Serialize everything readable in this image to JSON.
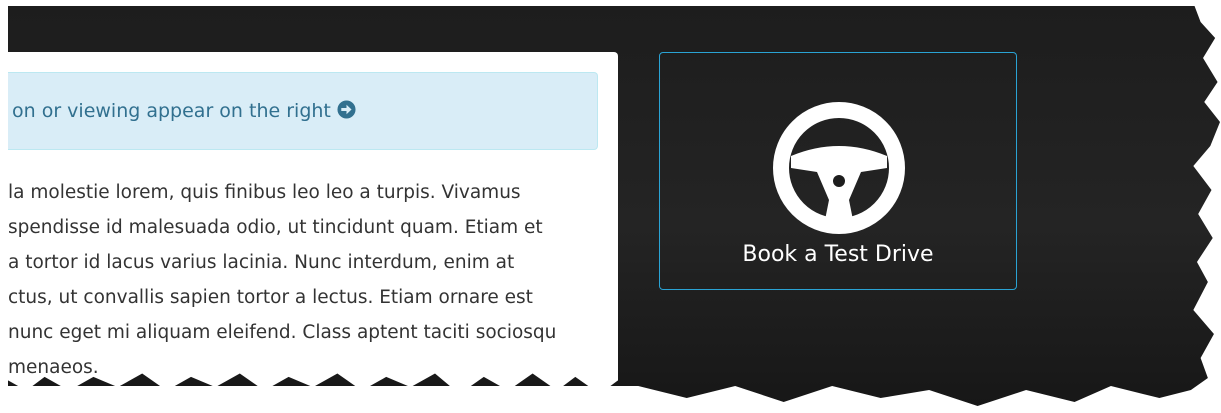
{
  "alert": {
    "text": "on or viewing appear on the right",
    "icon": "arrow-circle-right-icon"
  },
  "paragraph": {
    "lines": [
      "la molestie lorem, quis finibus leo leo a turpis. Vivamus",
      "spendisse id malesuada odio, ut tincidunt quam. Etiam et",
      "a tortor id lacus varius lacinia. Nunc interdum, enim at",
      "ctus, ut convallis sapien tortor a lectus. Etiam ornare est",
      "nunc eget mi aliquam eleifend. Class aptent taciti sociosqu",
      "menaeos."
    ]
  },
  "cta": {
    "label": "Book a Test Drive",
    "icon": "steering-wheel-icon"
  },
  "colors": {
    "dark_background": "#1d1d1d",
    "alert_background": "#d9edf7",
    "alert_text": "#31708f",
    "cta_border": "#2aa3d4",
    "body_text": "#333333"
  }
}
